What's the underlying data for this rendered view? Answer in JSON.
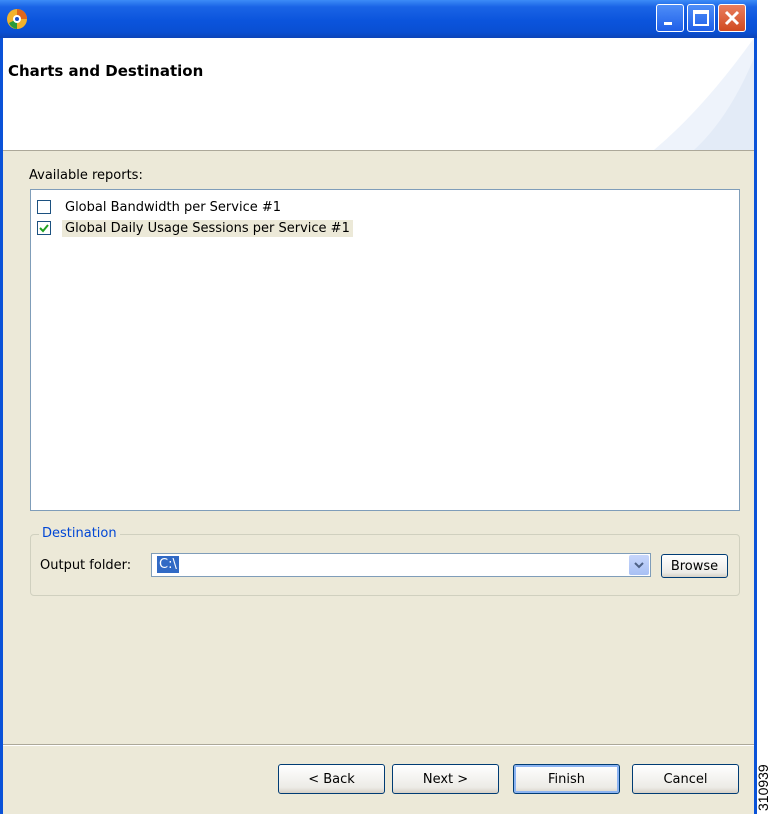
{
  "window": {
    "title": "",
    "controls": [
      "minimize-icon",
      "maximize-icon",
      "close-icon"
    ]
  },
  "banner": {
    "title": "Charts and Destination"
  },
  "reports": {
    "label": "Available reports:",
    "items": [
      {
        "label": "Global Bandwidth per Service #1",
        "checked": false
      },
      {
        "label": "Global Daily Usage Sessions per Service #1",
        "checked": true
      }
    ]
  },
  "destination": {
    "group_label": "Destination",
    "output_label": "Output folder:",
    "output_value": "C:\\",
    "browse_label": "Browse"
  },
  "buttons": {
    "back": "< Back",
    "next": "Next >",
    "finish": "Finish",
    "cancel": "Cancel"
  },
  "figure_id": "310939",
  "colors": {
    "titlebar": "#0a52d8",
    "dialog_bg": "#ece9d8",
    "legend_blue": "#0046d5",
    "selection": "#316ac5",
    "close_button": "#d04a21"
  }
}
